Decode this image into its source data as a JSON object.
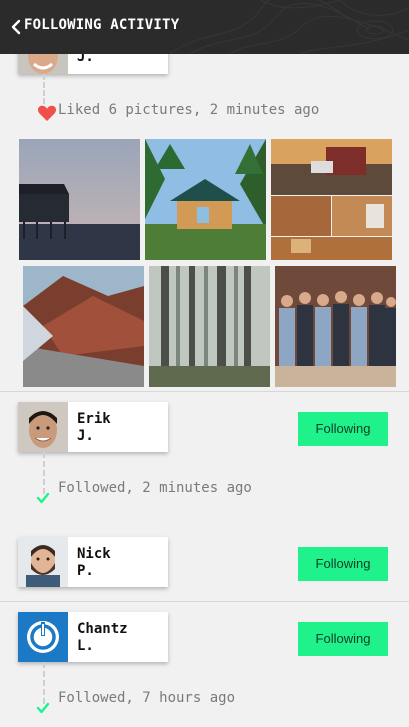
{
  "header": {
    "title": "FOLLOWING ACTIVITY"
  },
  "feed": {
    "top_user": {
      "last_initial": "J."
    },
    "liked_activity": {
      "text": "Liked 6 pictures, 2 minutes ago"
    },
    "users": [
      {
        "first": "Erik",
        "last": "J.",
        "button": "Following",
        "activity": "Followed, 2 minutes ago"
      },
      {
        "first": "Nick",
        "last": "P.",
        "button": "Following"
      },
      {
        "first": "Chantz",
        "last": "L.",
        "button": "Following",
        "activity": "Followed, 7 hours ago"
      }
    ]
  },
  "colors": {
    "accent": "#1ff28a",
    "header_bg": "#2b2b2b",
    "heart": "#f0504a",
    "check": "#1ff28a"
  }
}
